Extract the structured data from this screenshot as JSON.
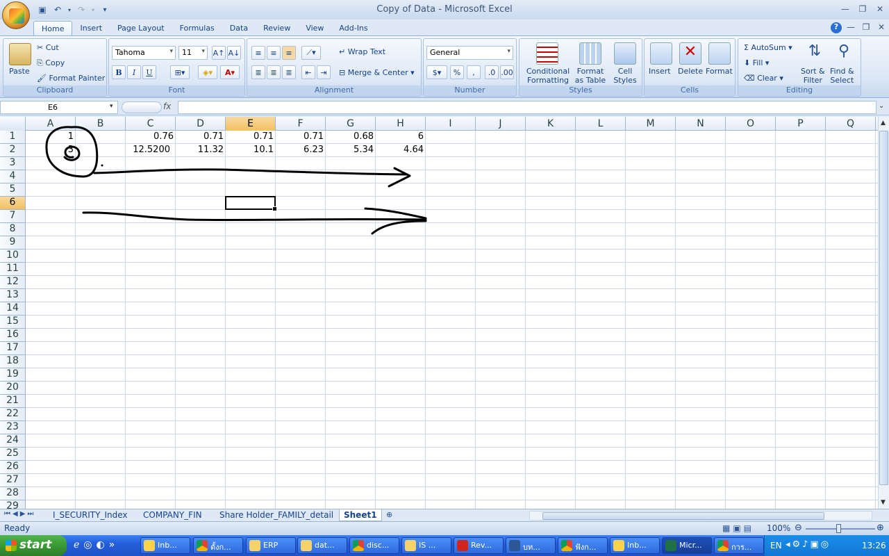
{
  "window": {
    "title": "Copy of Data - Microsoft Excel"
  },
  "ribbon": {
    "tabs": [
      "Home",
      "Insert",
      "Page Layout",
      "Formulas",
      "Data",
      "Review",
      "View",
      "Add-Ins"
    ],
    "clipboard": {
      "paste": "Paste",
      "cut": "Cut",
      "copy": "Copy",
      "format_painter": "Format Painter",
      "label": "Clipboard"
    },
    "font": {
      "name": "Tahoma",
      "size": "11",
      "label": "Font",
      "bold": "B",
      "italic": "I",
      "underline": "U"
    },
    "alignment": {
      "wrap": "Wrap Text",
      "merge": "Merge & Center",
      "label": "Alignment"
    },
    "number": {
      "format": "General",
      "label": "Number",
      "percent": "%",
      "comma": ","
    },
    "styles": {
      "conditional": "Conditional",
      "conditional2": "Formatting",
      "format_table": "Format",
      "format_table2": "as Table",
      "cell_styles": "Cell",
      "cell_styles2": "Styles",
      "label": "Styles"
    },
    "cells": {
      "insert": "Insert",
      "delete": "Delete",
      "format": "Format",
      "label": "Cells"
    },
    "editing": {
      "autosum": "AutoSum",
      "fill": "Fill",
      "clear": "Clear",
      "sort": "Sort &",
      "sort2": "Filter",
      "find": "Find &",
      "find2": "Select",
      "label": "Editing"
    }
  },
  "formula_bar": {
    "name_box": "E6",
    "fx": "fx",
    "formula": ""
  },
  "sheet": {
    "columns": [
      "A",
      "B",
      "C",
      "D",
      "E",
      "F",
      "G",
      "H",
      "I",
      "J",
      "K",
      "L",
      "M",
      "N",
      "O",
      "P",
      "Q"
    ],
    "selected_column": "E",
    "selected_row": 6,
    "rows": [
      "1",
      "2",
      "3",
      "4",
      "5",
      "6",
      "7",
      "8",
      "9",
      "10",
      "11",
      "12",
      "13",
      "14",
      "15",
      "16",
      "17",
      "18",
      "19",
      "20",
      "21",
      "22",
      "23",
      "24",
      "25",
      "26",
      "27",
      "28",
      "29"
    ],
    "row1": {
      "A": "1",
      "C": "0.76",
      "D": "0.71",
      "E": "0.71",
      "F": "0.71",
      "G": "0.68",
      "H": "6"
    },
    "row2": {
      "A": "3",
      "C": "12.5200",
      "D": "11.32",
      "E": "10.1",
      "F": "6.23",
      "G": "5.34",
      "H": "4.64"
    }
  },
  "sheet_tabs": [
    "I_SECURITY_Index",
    "COMPANY_FIN",
    "Share Holder_FAMILY_detail",
    "Sheet1"
  ],
  "active_sheet": "Sheet1",
  "status": {
    "text": "Ready",
    "zoom": "100%"
  },
  "taskbar": {
    "start": "start",
    "tasks": [
      "Inb...",
      "ตั้งก...",
      "ERP",
      "dat...",
      "disc...",
      "IS ...",
      "Rev...",
      "บท...",
      "ฟังก...",
      "Inb...",
      "Micr...",
      "การ..."
    ],
    "lang": "EN",
    "clock": "13:26"
  },
  "colors": {
    "accent": "#15428b",
    "selection": "#f1c15f",
    "taskbar": "#245edb",
    "start": "#3a9a34"
  }
}
